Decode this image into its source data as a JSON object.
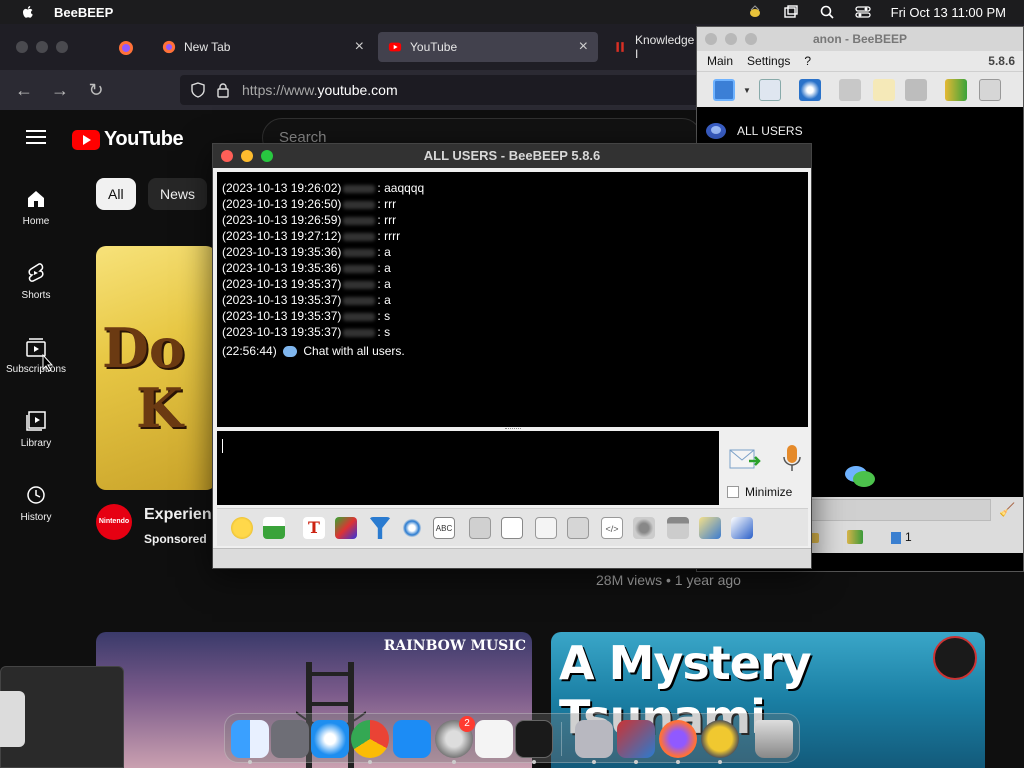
{
  "menubar": {
    "app_name": "BeeBEEP",
    "datetime": "Fri Oct 13  11:00 PM"
  },
  "browser": {
    "tabs": [
      {
        "label": "New Tab"
      },
      {
        "label": "YouTube"
      },
      {
        "label": "Knowledge I"
      }
    ],
    "url_scheme": "https://www.",
    "url_host": "youtube.com"
  },
  "youtube": {
    "logo_text": "YouTube",
    "search_placeholder": "Search",
    "sidebar": [
      {
        "label": "Home"
      },
      {
        "label": "Shorts"
      },
      {
        "label": "Subscriptions"
      },
      {
        "label": "Library"
      },
      {
        "label": "History"
      }
    ],
    "chips": [
      {
        "label": "All"
      },
      {
        "label": "News"
      }
    ],
    "video1": {
      "thumb_text": "Do",
      "thumb_text2": "K",
      "title": "Experienc",
      "sponsored": "Sponsored",
      "channel_mark": "Nintendo"
    },
    "views": "28M views • 1 year ago",
    "video2": {
      "label": "RAINBOW MUSIC"
    },
    "video3": {
      "label": "A Mystery Tsunami"
    }
  },
  "beebeep_main": {
    "title": "anon - BeeBEEP",
    "menu": [
      "Main",
      "Settings",
      "?"
    ],
    "version": "5.8.6",
    "users_label": "ALL USERS",
    "status_count": "1"
  },
  "chat": {
    "title": "ALL USERS - BeeBEEP 5.8.6",
    "messages": [
      {
        "time": "(2023-10-13 19:26:02)",
        "text": ": aaqqqq"
      },
      {
        "time": "(2023-10-13 19:26:50)",
        "text": ": rrr"
      },
      {
        "time": "(2023-10-13 19:26:59)",
        "text": ": rrr"
      },
      {
        "time": "(2023-10-13 19:27:12)",
        "text": ": rrrr"
      },
      {
        "time": "(2023-10-13 19:35:36)",
        "text": ": a"
      },
      {
        "time": "(2023-10-13 19:35:36)",
        "text": ": a"
      },
      {
        "time": "(2023-10-13 19:35:37)",
        "text": ": a"
      },
      {
        "time": "(2023-10-13 19:35:37)",
        "text": ": a"
      },
      {
        "time": "(2023-10-13 19:35:37)",
        "text": ": s"
      },
      {
        "time": "(2023-10-13 19:35:37)",
        "text": ": s"
      }
    ],
    "system_message": {
      "time": "(22:56:44)",
      "text": "Chat with all users."
    },
    "minimize_label": "Minimize"
  },
  "dock": {
    "badge_count": "2"
  }
}
